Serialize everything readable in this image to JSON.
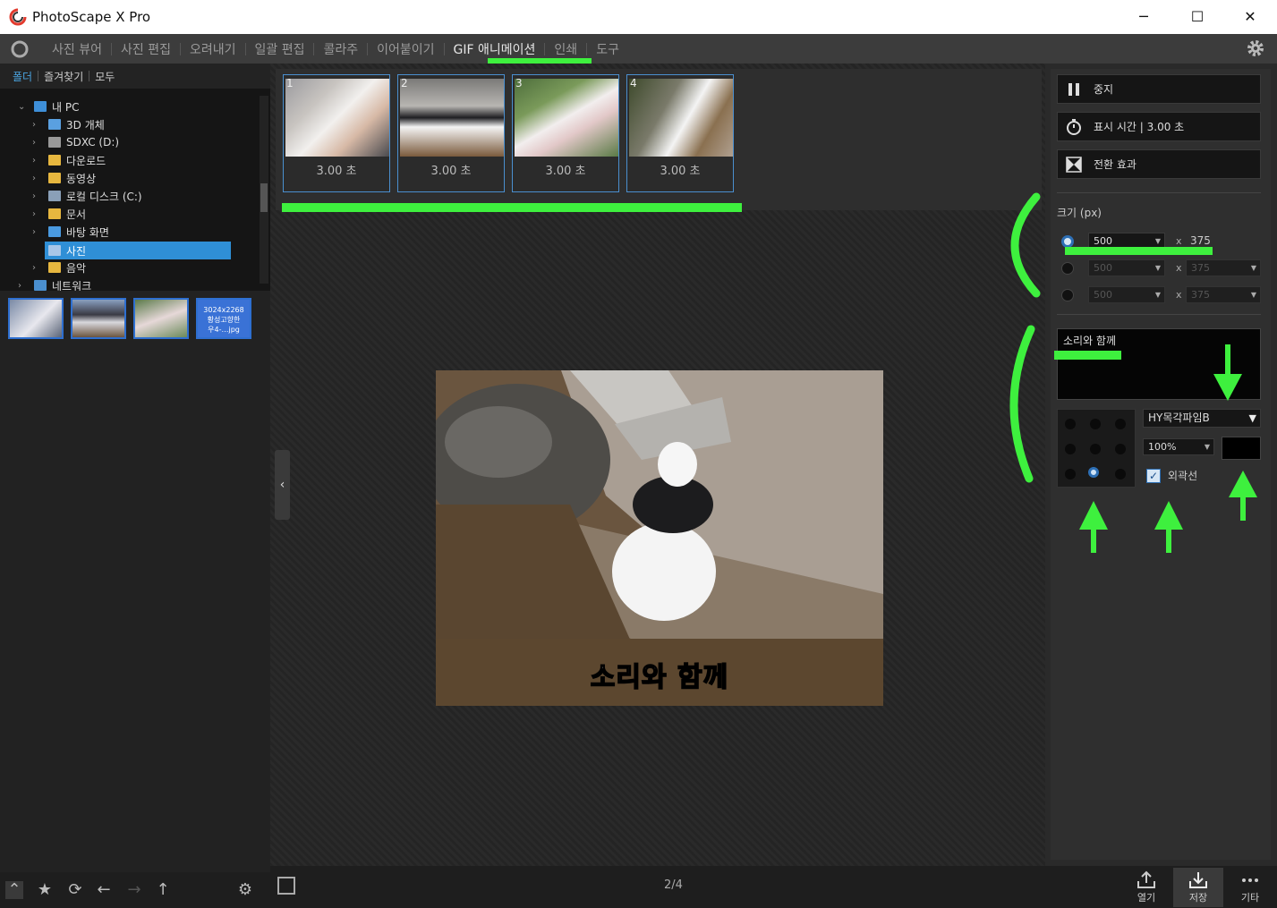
{
  "window": {
    "title": "PhotoScape X Pro",
    "controls": [
      "─",
      "☐",
      "✕"
    ]
  },
  "menu": {
    "items": [
      "사진 뷰어",
      "사진 편집",
      "오려내기",
      "일괄 편집",
      "콜라주",
      "이어붙이기",
      "GIF 애니메이션",
      "인쇄",
      "도구"
    ],
    "active": "GIF 애니메이션"
  },
  "left_panel": {
    "tabs": [
      "폴더",
      "즐겨찾기",
      "모두"
    ],
    "active_tab": "폴더",
    "tree": [
      {
        "label": "내 PC",
        "level": 0,
        "expanded": true
      },
      {
        "label": "3D 개체",
        "level": 1
      },
      {
        "label": "SDXC (D:)",
        "level": 1
      },
      {
        "label": "다운로드",
        "level": 1
      },
      {
        "label": "동영상",
        "level": 1
      },
      {
        "label": "로컬 디스크 (C:)",
        "level": 1
      },
      {
        "label": "문서",
        "level": 1
      },
      {
        "label": "바탕 화면",
        "level": 1
      },
      {
        "label": "사진",
        "level": 1,
        "selected": true
      },
      {
        "label": "음악",
        "level": 1
      },
      {
        "label": "네트워크",
        "level": 0
      }
    ],
    "thumb_4_text": "3024x2268\n황성고향한\n우4-…jpg"
  },
  "frames": [
    {
      "num": "1",
      "duration": "3.00 초"
    },
    {
      "num": "2",
      "duration": "3.00 초"
    },
    {
      "num": "3",
      "duration": "3.00 초"
    },
    {
      "num": "4",
      "duration": "3.00 초"
    }
  ],
  "preview": {
    "caption": "소리와 함께"
  },
  "bottom": {
    "pager": "2/4",
    "open_label": "열기",
    "save_label": "저장",
    "more_label": "기타"
  },
  "right_panel": {
    "stop_label": "중지",
    "display_time_label": "표시 시간 | 3.00 초",
    "transition_label": "전환 효과",
    "size_label": "크기 (px)",
    "size_rows": [
      {
        "width": "500",
        "x": "x",
        "height": "375",
        "enabled": true,
        "selected": true
      },
      {
        "width": "500",
        "x": "x",
        "height": "375",
        "enabled": false,
        "selected": false
      },
      {
        "width": "500",
        "x": "x",
        "height": "375",
        "enabled": false,
        "selected": false
      }
    ],
    "text_value": "소리와 함께",
    "font": "HY목각파임B",
    "scale": "100%",
    "outline_label": "외곽선",
    "outline_checked": true,
    "text_color": "#000000",
    "text_position_selected": "bottom-center"
  },
  "colors": {
    "accent": "#2f8fd6",
    "annotation": "#3ef03e",
    "background": "#2b2b2b"
  }
}
